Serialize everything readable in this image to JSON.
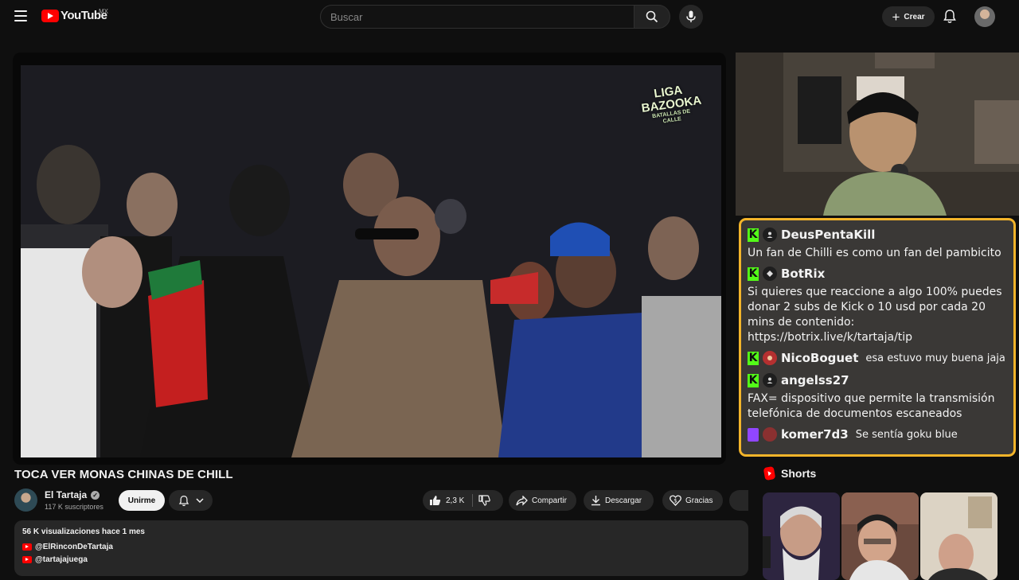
{
  "header": {
    "logo_text": "YouTube",
    "country_code": "MX",
    "search_placeholder": "Buscar",
    "create_label": "Crear"
  },
  "video": {
    "overlay_brand": "LIGA BAZOOKA",
    "overlay_brand_sub": "BATALLAS DE CALLE"
  },
  "info": {
    "title": "TOCA VER MONAS CHINAS DE CHILL",
    "channel_name": "El Tartaja",
    "subscribers": "117 K suscriptores",
    "join_label": "Unirme",
    "likes": "2,3 K",
    "share_label": "Compartir",
    "download_label": "Descargar",
    "thanks_label": "Gracias"
  },
  "description": {
    "meta": "56 K visualizaciones  hace 1 mes",
    "links": [
      "@ElRinconDeTartaja",
      "@tartajajuega"
    ]
  },
  "chat": {
    "messages": [
      {
        "platform": "kick",
        "user": "DeusPentaKill",
        "text": "Un fan de Chilli es como un fan del pambicito"
      },
      {
        "platform": "kick",
        "user": "BotRix",
        "text": "Si quieres que reaccione a algo 100% puedes donar 2 subs de Kick o 10 usd por cada 20 mins de contenido: https://botrix.live/k/tartaja/tip"
      },
      {
        "platform": "kick",
        "user": "NicoBoguet",
        "text": "esa estuvo muy buena jaja"
      },
      {
        "platform": "kick",
        "user": "angelss27",
        "text": "FAX= dispositivo que permite la transmisión telefónica de documentos escaneados"
      },
      {
        "platform": "twitch",
        "user": "komer7d3",
        "text": "Se sentía goku blue"
      }
    ]
  },
  "shorts": {
    "title": "Shorts"
  },
  "colors": {
    "accent_red": "#ff0000",
    "chat_border": "#f3b42a",
    "kick_green": "#53fc18",
    "twitch_purple": "#9146ff"
  }
}
